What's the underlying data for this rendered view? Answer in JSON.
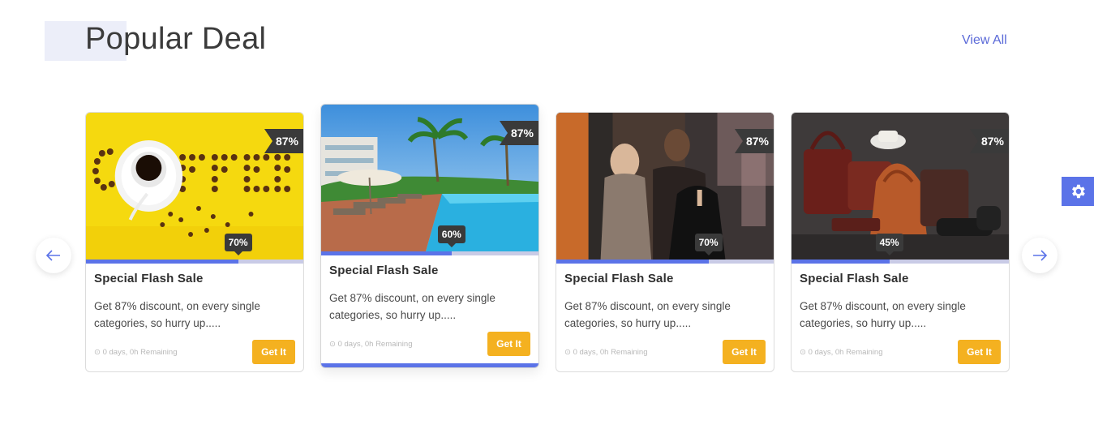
{
  "header": {
    "title": "Popular Deal",
    "view_all": "View All"
  },
  "colors": {
    "accent": "#5b73e8",
    "button": "#f4b120",
    "badge": "#3a3a3a"
  },
  "deals": [
    {
      "image": "coffee",
      "discount_badge": "87%",
      "progress_label": "70%",
      "progress": 0.7,
      "title": "Special Flash Sale",
      "description": "Get 87% discount, on every single categories, so hurry up.....",
      "remaining": "⊙ 0 days, 0h Remaining",
      "button": "Get It"
    },
    {
      "image": "resort-pool",
      "discount_badge": "87%",
      "progress_label": "60%",
      "progress": 0.6,
      "title": "Special Flash Sale",
      "description": "Get 87% discount, on every single categories, so hurry up.....",
      "remaining": "⊙ 0 days, 0h Remaining",
      "button": "Get It"
    },
    {
      "image": "clothing-shop",
      "discount_badge": "87%",
      "progress_label": "70%",
      "progress": 0.7,
      "title": "Special Flash Sale",
      "description": "Get 87% discount, on every single categories, so hurry up.....",
      "remaining": "⊙ 0 days, 0h Remaining",
      "button": "Get It"
    },
    {
      "image": "leather-bags",
      "discount_badge": "87%",
      "progress_label": "45%",
      "progress": 0.45,
      "title": "Special Flash Sale",
      "description": "Get 87% discount, on every single categories, so hurry up.....",
      "remaining": "⊙ 0 days, 0h Remaining",
      "button": "Get It"
    }
  ],
  "icons": {
    "prev": "arrow-left-icon",
    "next": "arrow-right-icon",
    "settings": "gear-icon"
  }
}
